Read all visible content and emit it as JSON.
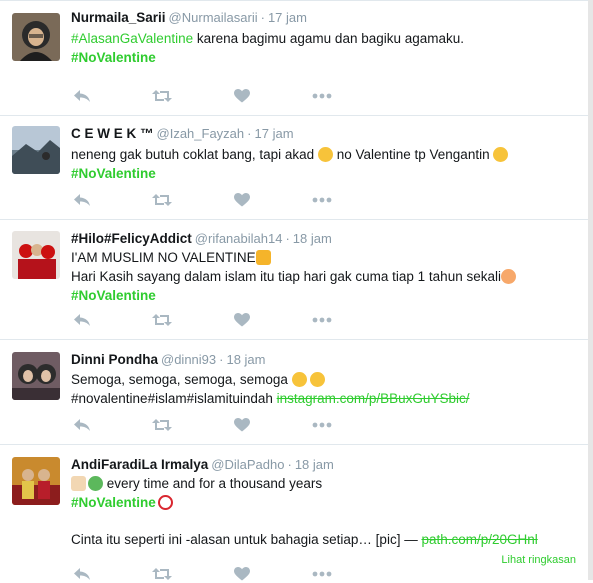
{
  "colors": {
    "accent": "#2fcc2f",
    "muted": "#8899a6",
    "icon": "#aab8c2",
    "divider": "#e1e8ed"
  },
  "tweets": [
    {
      "name": "Nurmaila_Sarii",
      "handle": "@Nurmailasarii",
      "time": "17 jam",
      "line1_tag": "#AlasanGaValentine",
      "line1_text": " karena bagimu agamu dan bagiku agamaku.",
      "line2_tag": "#NoValentine"
    },
    {
      "name": "C E W E K ™",
      "handle": "@Izah_Fayzah",
      "time": "17 jam",
      "line1_text_a": "neneng gak butuh coklat bang, tapi akad ",
      "line1_text_b": " no Valentine tp Vengantin ",
      "line2_tag": "#NoValentine"
    },
    {
      "name": "#Hilo#FelicyAddict",
      "handle": "@rifanabilah14",
      "time": "18 jam",
      "line1_text": "I'AM MUSLIM NO VALENTINE",
      "line2_text": "Hari Kasih sayang dalam islam itu tiap hari gak cuma tiap 1 tahun sekali",
      "line3_tag": "#NoValentine"
    },
    {
      "name": "Dinni Pondha",
      "handle": "@dinni93",
      "time": "18 jam",
      "line1_text": "Semoga, semoga, semoga, semoga ",
      "line2_text": "#novalentine#islam#islamituindah ",
      "line2_link": "instagram.com/p/BBuxGuYSbic/"
    },
    {
      "name": "AndiFaradiLa Irmalya",
      "handle": "@DilaPadho",
      "time": "18 jam",
      "line1_text": " every time and for a thousand years",
      "line2_tag": "#NoValentine",
      "line3_text": "Cinta itu seperti ini -alasan untuk bahagia setiap… [pic] — ",
      "line3_link": "path.com/p/20GHnl",
      "summary": "Lihat ringkasan"
    }
  ],
  "actions": {
    "reply_icon": "reply-icon",
    "retweet_icon": "retweet-icon",
    "like_icon": "heart-icon",
    "more_icon": "more-icon"
  }
}
